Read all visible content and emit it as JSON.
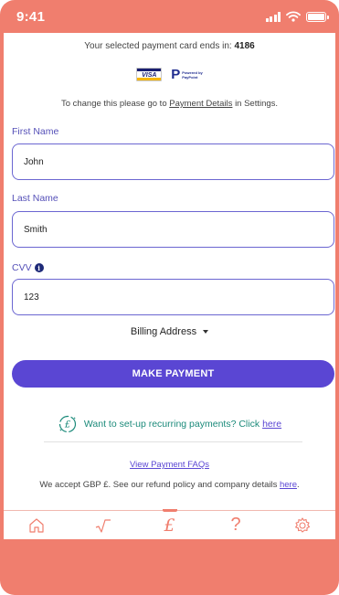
{
  "status_bar": {
    "time": "9:41",
    "color": "#ffffff",
    "frame_color": "#f07e6e"
  },
  "card_info": {
    "prefix": "Your selected payment card ends in:",
    "last_digits": "4186",
    "logos": [
      "visa-logo",
      "paypoint-logo"
    ],
    "visa_text": "VISA",
    "paypoint_text": "Powered by PayPoint"
  },
  "change_notice": {
    "before": "To change this please go to",
    "link": "Payment Details",
    "after": "in Settings."
  },
  "form": {
    "first_name": {
      "label": "First Name",
      "value": "John"
    },
    "last_name": {
      "label": "Last Name",
      "value": "Smith"
    },
    "cvv": {
      "label": "CVV",
      "value": "123",
      "info_icon": "info-icon"
    }
  },
  "billing": {
    "label": "Billing Address",
    "icon": "caret-down-icon"
  },
  "pay_button": {
    "label": "MAKE PAYMENT",
    "color": "#5a46d3"
  },
  "recurring": {
    "icon": "recurring-pound-icon",
    "text": "Want to set-up recurring payments? Click",
    "link": "here"
  },
  "footer": {
    "faq_link": "View Payment FAQs",
    "accept_text": "We accept GBP £. See our refund policy and company details",
    "accept_link": "here",
    "accept_end": "."
  },
  "nav": {
    "active": "nav-pound",
    "items": [
      "home-icon",
      "sqrt-icon",
      "pound-icon",
      "question-icon",
      "gear-icon"
    ],
    "pound_glyph": "£",
    "question_glyph": "?"
  }
}
